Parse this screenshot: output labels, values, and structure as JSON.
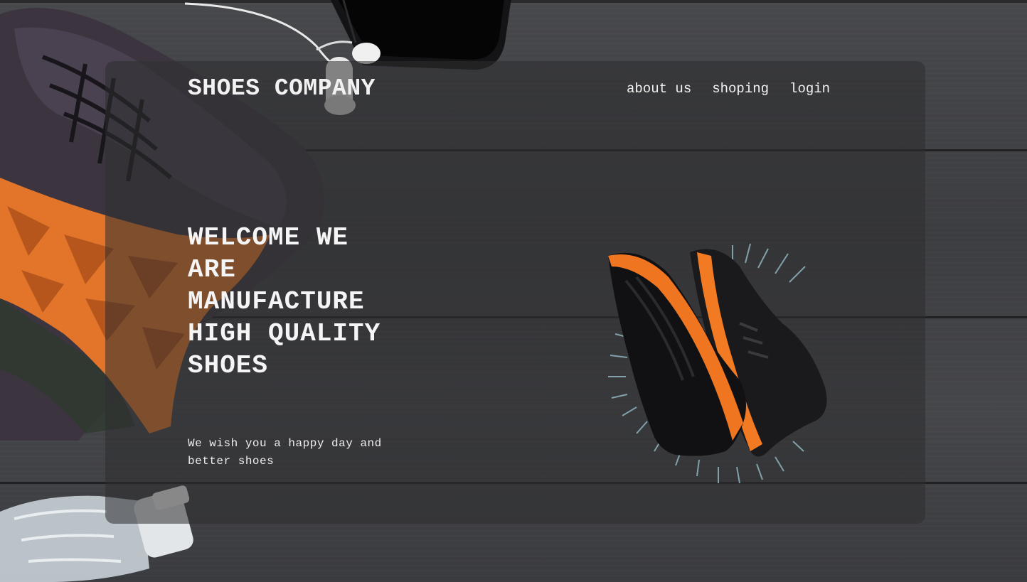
{
  "header": {
    "brand": "SHOES COMPANY",
    "nav": [
      {
        "label": "about us"
      },
      {
        "label": "shoping"
      },
      {
        "label": "login"
      }
    ]
  },
  "hero": {
    "title": "WELCOME WE ARE MANUFACTURE HIGH QUALITY SHOES",
    "subtitle": "We wish you a happy day and better shoes"
  },
  "images": {
    "background": "wooden-planks-with-sneakers-earphones-phone-bottle",
    "product": "black-orange-running-shoes-pair"
  },
  "colors": {
    "accent": "#ff7a1a",
    "text": "#f2f2f2",
    "panel": "#2d2d30"
  }
}
